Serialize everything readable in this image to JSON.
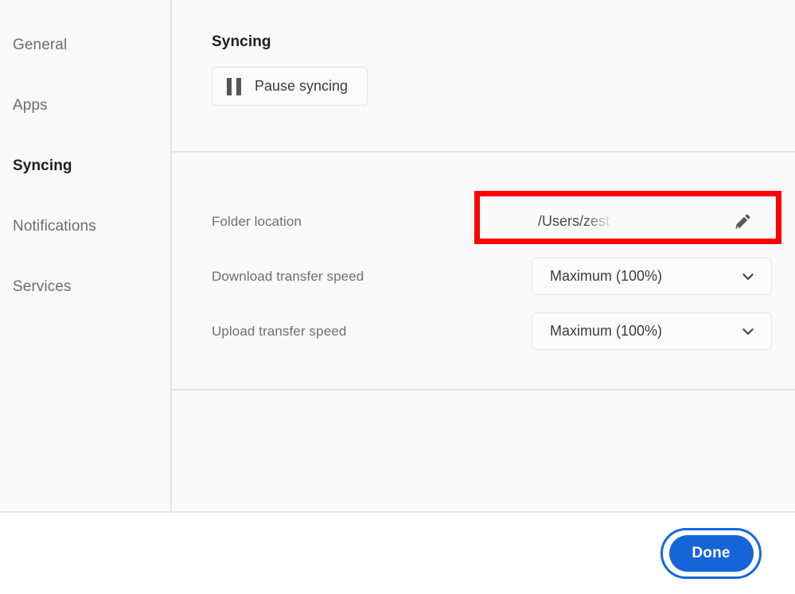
{
  "sidebar": {
    "items": [
      {
        "label": "General",
        "active": false
      },
      {
        "label": "Apps",
        "active": false
      },
      {
        "label": "Syncing",
        "active": true
      },
      {
        "label": "Notifications",
        "active": false
      },
      {
        "label": "Services",
        "active": false
      }
    ]
  },
  "syncing_section": {
    "title": "Syncing",
    "pause_button_label": "Pause syncing",
    "pause_icon": "pause-icon"
  },
  "settings_section": {
    "rows": [
      {
        "label": "Folder location",
        "type": "path",
        "value": "/Users/zest",
        "edit_icon": "pencil-icon",
        "highlighted": true
      },
      {
        "label": "Download transfer speed",
        "type": "dropdown",
        "value": "Maximum (100%)",
        "chevron_icon": "chevron-down-icon"
      },
      {
        "label": "Upload transfer speed",
        "type": "dropdown",
        "value": "Maximum (100%)",
        "chevron_icon": "chevron-down-icon"
      }
    ]
  },
  "footer": {
    "done_label": "Done"
  },
  "colors": {
    "accent_blue": "#1565d8",
    "focus_ring_blue": "#1668dc",
    "highlight_red": "#ff0000",
    "panel_bg": "#f9f9f9",
    "divider": "#e6e6e6"
  }
}
